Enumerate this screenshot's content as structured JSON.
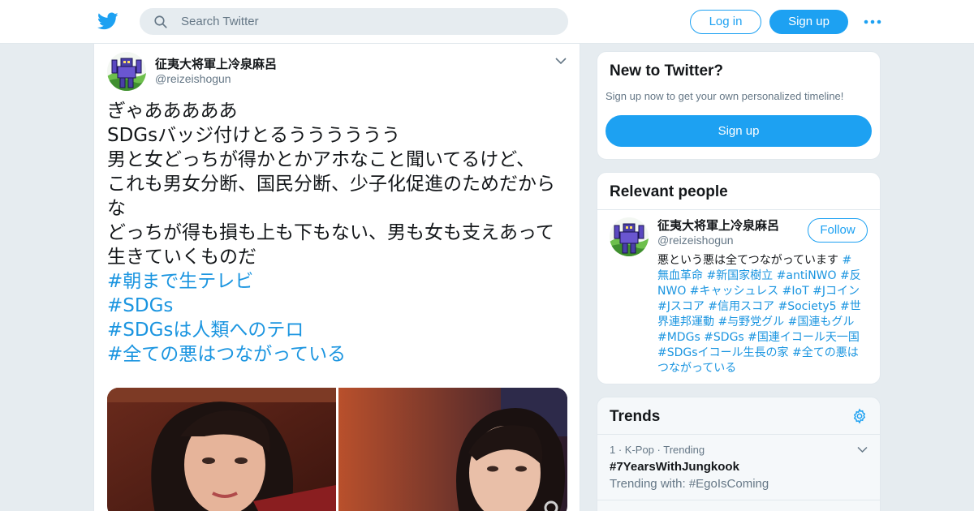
{
  "topbar": {
    "search_placeholder": "Search Twitter",
    "login_label": "Log in",
    "signup_label": "Sign up",
    "brand_color": "#1da1f2"
  },
  "tweet": {
    "author_name": "征夷大将軍上冷泉麻呂",
    "author_handle": "@reizeishogun",
    "lines": [
      "ぎゃあああああ",
      "SDGsバッジ付けとるうううううう",
      "男と女どっちが得かとかアホなこと聞いてるけど、",
      "これも男女分断、国民分断、少子化促進のためだから",
      "な",
      "どっちが得も損も上も下もない、男も女も支えあって",
      "生きていくものだ"
    ],
    "hashtags": [
      "#朝まで生テレビ",
      "#SDGs",
      "#SDGsは人類へのテロ",
      "#全ての悪はつながっている"
    ]
  },
  "new_to_twitter": {
    "title": "New to Twitter?",
    "subtitle": "Sign up now to get your own personalized timeline!",
    "signup_label": "Sign up"
  },
  "relevant_people": {
    "title": "Relevant people",
    "name": "征夷大将軍上冷泉麻呂",
    "handle": "@reizeishogun",
    "follow_label": "Follow",
    "bio_lines": [
      [
        {
          "t": "悪という悪は全てつながっています ",
          "tag": false
        },
        {
          "t": "#",
          "tag": true
        }
      ],
      [
        {
          "t": "無血革命 #新国家樹立 #antiNWO #反",
          "tag": true
        }
      ],
      [
        {
          "t": "NWO #キャッシュレス #IoT #Jコイン",
          "tag": true
        }
      ],
      [
        {
          "t": "#Jスコア #信用スコア #Society5 #世",
          "tag": true
        }
      ],
      [
        {
          "t": "界連邦運動 #与野党グル #国連もグル",
          "tag": true
        }
      ],
      [
        {
          "t": "#MDGs #SDGs #国連イコール天一国",
          "tag": true
        }
      ],
      [
        {
          "t": "#SDGsイコール生長の家 #全ての悪は",
          "tag": true
        }
      ],
      [
        {
          "t": "つながっている",
          "tag": true
        }
      ]
    ]
  },
  "trends": {
    "title": "Trends",
    "items": [
      {
        "meta": "1 · K-Pop · Trending",
        "name": "#7YearsWithJungkook",
        "with": "Trending with: #EgoIsComing"
      }
    ]
  }
}
